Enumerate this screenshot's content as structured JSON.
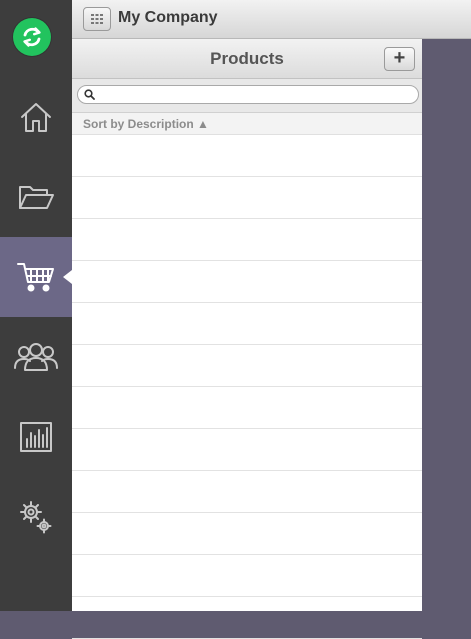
{
  "app": {
    "company": "My Company"
  },
  "colors": {
    "sync": "#22c35e",
    "rail": "#3d3d3d",
    "active": "#6c6887",
    "backdrop": "#5f5b70"
  },
  "rail": {
    "items": [
      {
        "name": "home",
        "icon": "home-icon",
        "active": false
      },
      {
        "name": "documents",
        "icon": "folder-icon",
        "active": false
      },
      {
        "name": "products",
        "icon": "shopping-cart-icon",
        "active": true
      },
      {
        "name": "customers",
        "icon": "users-icon",
        "active": false
      },
      {
        "name": "reports",
        "icon": "bar-chart-icon",
        "active": false
      },
      {
        "name": "settings",
        "icon": "gears-icon",
        "active": false
      }
    ]
  },
  "products": {
    "title": "Products",
    "add_label": "+",
    "search_placeholder": "",
    "sort_label": "Sort by Description ▲",
    "rows": [
      "",
      "",
      "",
      "",
      "",
      "",
      "",
      "",
      "",
      "",
      "",
      ""
    ]
  }
}
